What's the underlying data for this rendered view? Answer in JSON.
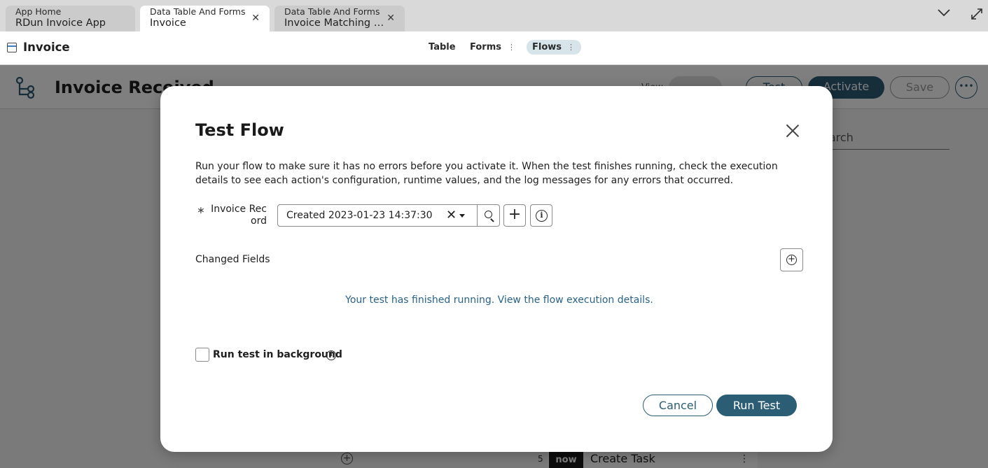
{
  "tabs": [
    {
      "group": "App Home",
      "name": "RDun Invoice App",
      "active": false
    },
    {
      "group": "Data Table And Forms",
      "name": "Invoice",
      "active": true,
      "close_icon": "close-icon"
    },
    {
      "group": "Data Table And Forms",
      "name": "Invoice Matching Ta...",
      "active": false,
      "close_icon": "close-icon"
    }
  ],
  "tabstrip": {
    "overflow_icon": "chevron-down-icon",
    "expand_icon": "expand-icon"
  },
  "app_header": {
    "title": "Invoice",
    "nav": [
      {
        "label": "Table",
        "active": false
      },
      {
        "label": "Forms",
        "active": false
      },
      {
        "label": "Flows",
        "active": true
      }
    ]
  },
  "background": {
    "flow_title": "Invoice Received",
    "view_label": "View",
    "test_label": "Test",
    "activate_label": "Activate",
    "save_label": "Save",
    "search_label": "earch",
    "step_number": "5",
    "step_badge": "now",
    "step_label": "Create Task"
  },
  "modal": {
    "title": "Test Flow",
    "description": "Run your flow to make sure it has no errors before you activate it. When the test finishes running, check the execution details to see each action's configuration, runtime values, and the log messages for any errors that occurred.",
    "record_field": {
      "required_marker": "∗",
      "label": "Invoice Record",
      "value": "Created 2023-01-23 14:37:30",
      "clear_glyph": "✕"
    },
    "changed_fields_label": "Changed Fields",
    "status_message": "Your test has finished running. View the flow execution details.",
    "background_checkbox": {
      "label": "Run test in background",
      "checked": false
    },
    "cancel_label": "Cancel",
    "run_label": "Run Test"
  },
  "colors": {
    "accent": "#2b5d75",
    "link": "#2a6285",
    "overlay": "rgba(0,0,0,0.5)"
  }
}
